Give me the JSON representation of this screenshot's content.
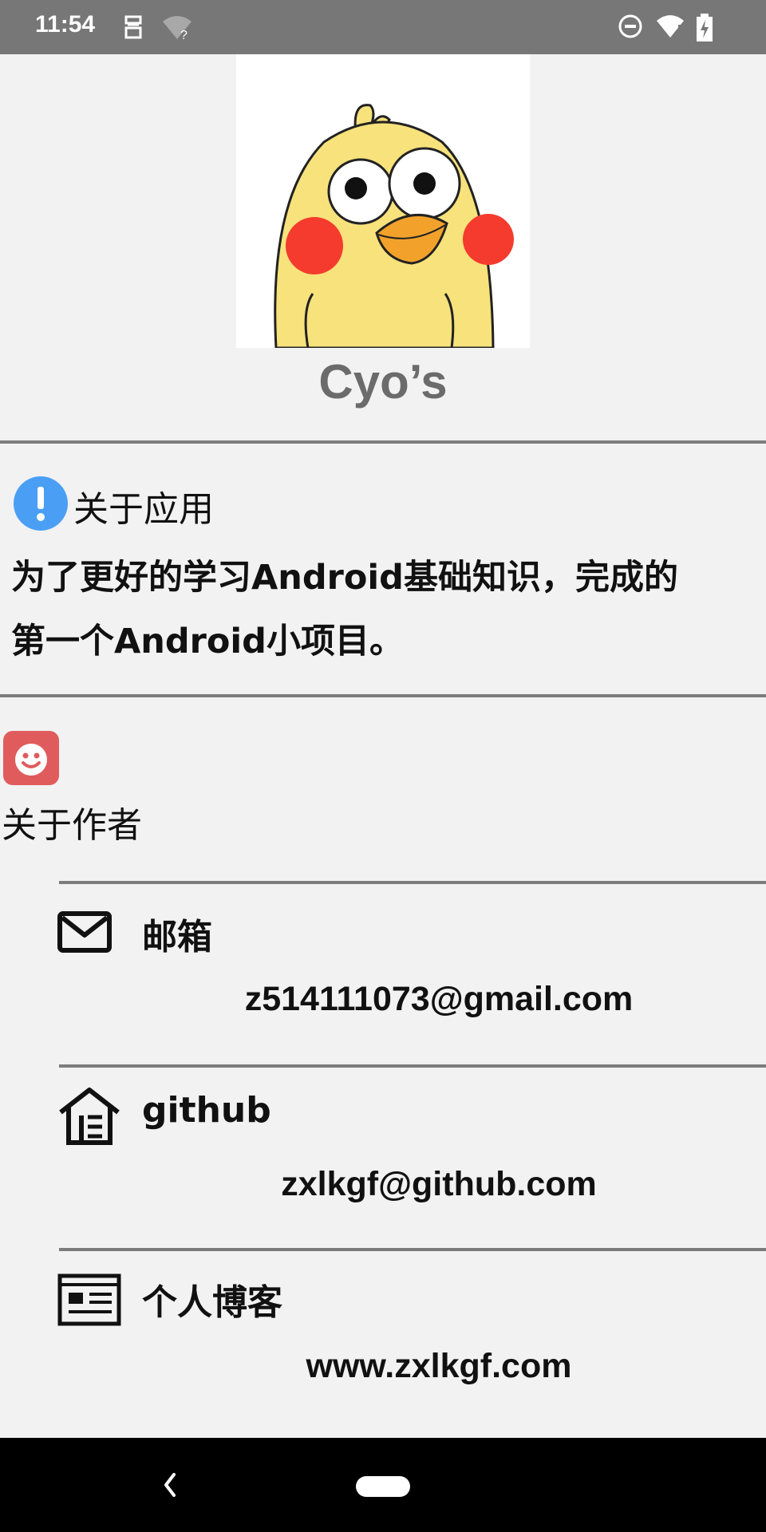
{
  "status_bar": {
    "time": "11:54",
    "icons": [
      "notification-icon",
      "wifi-question-icon",
      "do-not-disturb-icon",
      "wifi-icon",
      "battery-charging-icon"
    ]
  },
  "profile": {
    "name": "Cyo’s",
    "avatar": "cartoon-chick-avatar"
  },
  "about_app": {
    "title": "关于应用",
    "icon": "info-icon",
    "icon_color": "#4a9ff5",
    "description_line1": "为了更好的学习Android基础知识，完成的",
    "description_line2": "第一个Android小项目。"
  },
  "about_author": {
    "title": "关于作者",
    "icon": "smiley-icon",
    "icon_color": "#e05c5c",
    "contacts": [
      {
        "icon": "mail-icon",
        "title": "邮箱",
        "value": "z514111073@gmail.com"
      },
      {
        "icon": "github-house-icon",
        "title": "github",
        "value": "zxlkgf@github.com"
      },
      {
        "icon": "blog-icon",
        "title": "个人博客",
        "value": "www.zxlkgf.com"
      }
    ]
  },
  "nav_bar": {
    "buttons": [
      "back",
      "home"
    ]
  }
}
